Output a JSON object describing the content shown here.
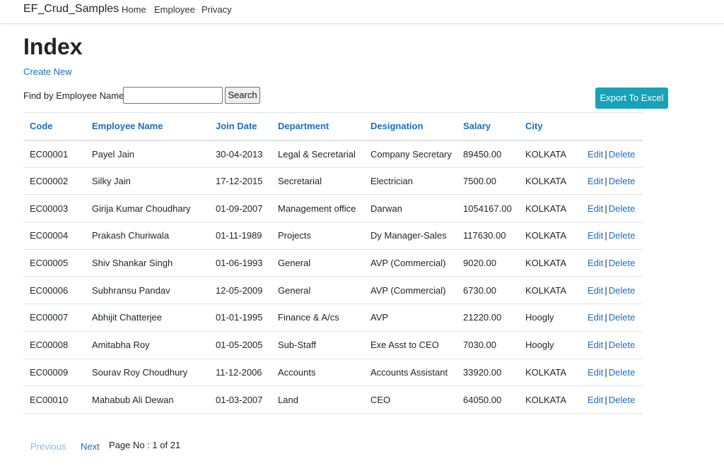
{
  "navbar": {
    "brand": "EF_Crud_Samples",
    "links": [
      "Home",
      "Employee",
      "Privacy"
    ]
  },
  "page": {
    "title": "Index",
    "create_link": "Create New"
  },
  "search": {
    "label": "Find by Employee Name:",
    "value": "",
    "button": "Search"
  },
  "export_button": "Export To Excel",
  "table": {
    "headers": [
      "Code",
      "Employee Name",
      "Join Date",
      "Department",
      "Designation",
      "Salary",
      "City"
    ],
    "actions": {
      "edit": "Edit",
      "separator": "|",
      "delete": "Delete"
    },
    "rows": [
      {
        "code": "EC00001",
        "name": "Payel Jain",
        "join_date": "30-04-2013",
        "department": "Legal & Secretarial",
        "designation": "Company Secretary",
        "salary": "89450.00",
        "city": "KOLKATA"
      },
      {
        "code": "EC00002",
        "name": "Silky Jain",
        "join_date": "17-12-2015",
        "department": "Secretarial",
        "designation": "Electrician",
        "salary": "7500.00",
        "city": "KOLKATA"
      },
      {
        "code": "EC00003",
        "name": "Girija Kumar Choudhary",
        "join_date": "01-09-2007",
        "department": "Management office",
        "designation": "Darwan",
        "salary": "1054167.00",
        "city": "KOLKATA"
      },
      {
        "code": "EC00004",
        "name": "Prakash Churiwala",
        "join_date": "01-11-1989",
        "department": "Projects",
        "designation": "Dy Manager-Sales",
        "salary": "117630.00",
        "city": "KOLKATA"
      },
      {
        "code": "EC00005",
        "name": "Shiv Shankar Singh",
        "join_date": "01-06-1993",
        "department": "General",
        "designation": "AVP (Commercial)",
        "salary": "9020.00",
        "city": "KOLKATA"
      },
      {
        "code": "EC00006",
        "name": "Subhransu Pandav",
        "join_date": "12-05-2009",
        "department": "General",
        "designation": "AVP (Commercial)",
        "salary": "6730.00",
        "city": "KOLKATA"
      },
      {
        "code": "EC00007",
        "name": "Abhijit Chatterjee",
        "join_date": "01-01-1995",
        "department": "Finance & A/cs",
        "designation": "AVP",
        "salary": "21220.00",
        "city": "Hoogly"
      },
      {
        "code": "EC00008",
        "name": "Amitabha Roy",
        "join_date": "01-05-2005",
        "department": "Sub-Staff",
        "designation": "Exe Asst to CEO",
        "salary": "7030.00",
        "city": "Hoogly"
      },
      {
        "code": "EC00009",
        "name": "Sourav Roy Choudhury",
        "join_date": "11-12-2006",
        "department": "Accounts",
        "designation": "Accounts Assistant",
        "salary": "33920.00",
        "city": "KOLKATA"
      },
      {
        "code": "EC00010",
        "name": "Mahabub Ali Dewan",
        "join_date": "01-03-2007",
        "department": "Land",
        "designation": "CEO",
        "salary": "64050.00",
        "city": "KOLKATA"
      }
    ]
  },
  "pager": {
    "previous": "Previous",
    "next": "Next",
    "info": "Page No : 1 of 21"
  },
  "colors": {
    "link": "#1b6ec2",
    "export_button": "#17a2b8",
    "disabled_link": "#8fb8e3"
  }
}
